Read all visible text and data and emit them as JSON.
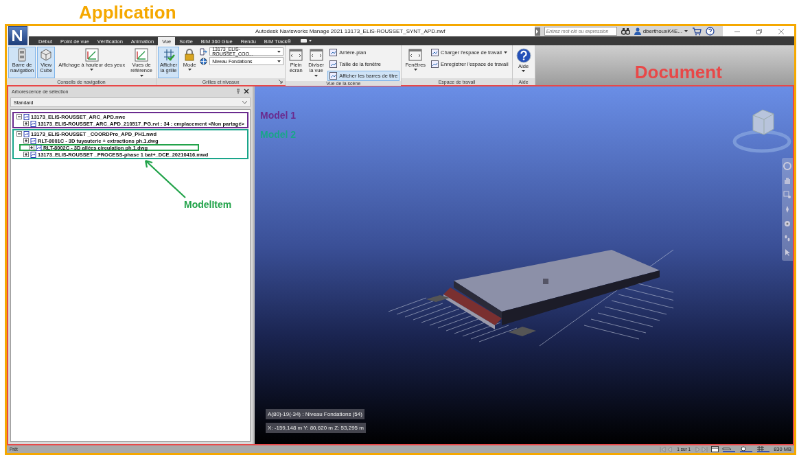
{
  "annotations": {
    "application": "Application",
    "document": "Document",
    "model_item": "ModelItem"
  },
  "window": {
    "title": "Autodesk Navisworks Manage 2021   13173_ELIS-ROUSSET_SYNT_APD.nwf",
    "search_placeholder": "Entrez mot-clé ou expression",
    "user": "dberthouxK4E..."
  },
  "tabs": [
    {
      "label": "Début",
      "selected": false
    },
    {
      "label": "Point de vue",
      "selected": false
    },
    {
      "label": "Vérification",
      "selected": false
    },
    {
      "label": "Animation",
      "selected": false
    },
    {
      "label": "Vue",
      "selected": true
    },
    {
      "label": "Sortie",
      "selected": false
    },
    {
      "label": "BIM 360 Glue",
      "selected": false
    },
    {
      "label": "Rendu",
      "selected": false
    },
    {
      "label": "BIM Track®",
      "selected": false
    }
  ],
  "ribbon": {
    "groups": [
      {
        "label": "Conseils de navigation",
        "items": [
          {
            "kind": "large",
            "label": "Barre de\nnavigation",
            "selected": true,
            "dropdown": false
          },
          {
            "kind": "large",
            "label": "View\nCube",
            "selected": true,
            "dropdown": false
          },
          {
            "kind": "large",
            "label": "Affichage à hauteur des yeux",
            "selected": false,
            "dropdown": true
          },
          {
            "kind": "large",
            "label": "Vues de\nréférence",
            "selected": false,
            "dropdown": true
          }
        ]
      },
      {
        "label": "Grilles et niveaux",
        "launcher": true,
        "items": [
          {
            "kind": "large",
            "label": "Afficher\nla grille",
            "selected": true,
            "dropdown": false
          },
          {
            "kind": "large",
            "label": "Mode",
            "selected": false,
            "dropdown": true
          },
          {
            "kind": "stack",
            "items": [
              {
                "kind": "combo",
                "value": "13173_ELIS-ROUSSET_COO..."
              },
              {
                "kind": "combo",
                "value": "Niveau Fondations"
              }
            ]
          }
        ]
      },
      {
        "label": "Vue de la scène",
        "items": [
          {
            "kind": "large",
            "label": "Plein\nécran",
            "selected": false,
            "dropdown": false
          },
          {
            "kind": "large",
            "label": "Diviser\nla vue",
            "selected": false,
            "dropdown": true
          },
          {
            "kind": "stack",
            "items": [
              {
                "kind": "small",
                "label": "Arrière-plan",
                "selected": false,
                "dropdown": false
              },
              {
                "kind": "small",
                "label": "Taille de la fenêtre",
                "selected": false,
                "dropdown": false
              },
              {
                "kind": "small",
                "label": "Afficher les barres de titre",
                "selected": true,
                "dropdown": false
              }
            ]
          }
        ]
      },
      {
        "label": "Espace de travail",
        "items": [
          {
            "kind": "large",
            "label": "Fenêtres",
            "selected": false,
            "dropdown": true
          },
          {
            "kind": "stack",
            "items": [
              {
                "kind": "small",
                "label": "Charger l'espace de travail",
                "selected": false,
                "dropdown": true
              },
              {
                "kind": "small",
                "label": "Enregistrer l'espace de travail",
                "selected": false,
                "dropdown": false
              }
            ]
          }
        ]
      },
      {
        "label": "Aide",
        "items": [
          {
            "kind": "help",
            "label": "Aide",
            "selected": false,
            "dropdown": true
          }
        ]
      }
    ]
  },
  "selection_tree": {
    "title": "Arborescence de sélection",
    "filter": "Standard",
    "items": [
      {
        "label": "13173_ELIS-ROUSSET_ARC_APD.nwc",
        "expanded": true,
        "color": "#6a2b8f",
        "children": [
          {
            "label": "13173_ELIS-ROUSSET_ARC_APD_210517_PG.rvt : 34 : emplacement <Non partagé>",
            "expanded": false
          }
        ]
      },
      {
        "label": "13173_ELIS-ROUSSET _COORDPro_APD_PH1.nwd",
        "expanded": true,
        "color": "#1aa58a",
        "children": [
          {
            "label": "RLT-8001C - 3D tuyauterie + extractions ph.1.dwg",
            "expanded": false
          },
          {
            "label": "RLT-8002C - 3D allées circulation ph.1.dwg",
            "expanded": false,
            "color": "#22a34a"
          },
          {
            "label": "13173_ELIS-ROUSSET _PROCESS-phase 1 bat+_DCE_20210416.mwd",
            "expanded": false
          }
        ]
      }
    ]
  },
  "viewport": {
    "model_labels": [
      {
        "label": "Model 1",
        "color": "#6a2b8f"
      },
      {
        "label": "Model 2",
        "color": "#1aa58a"
      }
    ],
    "grid_info": "A(80)-19(-34) : Niveau Fondations (54)",
    "coordinates": "X: -159,148 m  Y: 80,620 m  Z: 53,295 m"
  },
  "status_bar": {
    "status": "Prêt",
    "page": "1 sur 1",
    "memory": "830 MB"
  }
}
